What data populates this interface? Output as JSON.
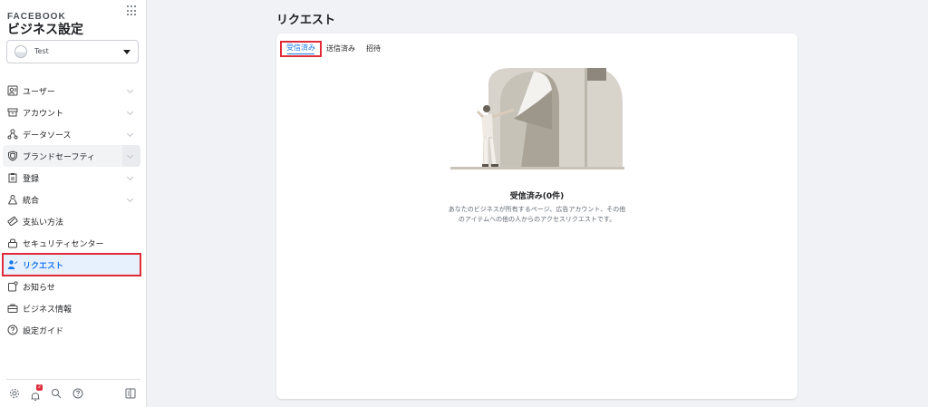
{
  "sidebar": {
    "brand": "FACEBOOK",
    "title": "ビジネス設定",
    "account_name": "Test",
    "items": [
      {
        "label": "ユーザー",
        "icon": "users-icon"
      },
      {
        "label": "アカウント",
        "icon": "accounts-icon"
      },
      {
        "label": "データソース",
        "icon": "data-sources-icon"
      },
      {
        "label": "ブランドセーフティ",
        "icon": "shield-icon"
      },
      {
        "label": "登録",
        "icon": "clipboard-icon"
      },
      {
        "label": "統合",
        "icon": "integrations-icon"
      },
      {
        "label": "支払い方法",
        "icon": "credit-card-icon"
      },
      {
        "label": "セキュリティセンター",
        "icon": "lock-icon"
      },
      {
        "label": "リクエスト",
        "icon": "person-request-icon"
      },
      {
        "label": "お知らせ",
        "icon": "notification-icon"
      },
      {
        "label": "ビジネス情報",
        "icon": "briefcase-icon"
      },
      {
        "label": "設定ガイド",
        "icon": "help-icon"
      }
    ],
    "bottom_icons": [
      "gear-icon",
      "bell-icon",
      "search-icon",
      "help-icon",
      "sidebar-toggle-icon"
    ],
    "notification_count": "2"
  },
  "main": {
    "title": "リクエスト",
    "tabs": [
      {
        "label": "受信済み",
        "active": true
      },
      {
        "label": "送信済み",
        "active": false
      },
      {
        "label": "招待",
        "active": false
      }
    ],
    "empty_title": "受信済み(0件)",
    "empty_desc_line1": "あなたのビジネスが所有するページ、広告アカウント、その他",
    "empty_desc_line2": "のアイテムへの他の人からのアクセスリクエストです。"
  },
  "colors": {
    "accent": "#1877f2",
    "highlight": "#e02c39",
    "active_bg": "#e7f0fd"
  }
}
